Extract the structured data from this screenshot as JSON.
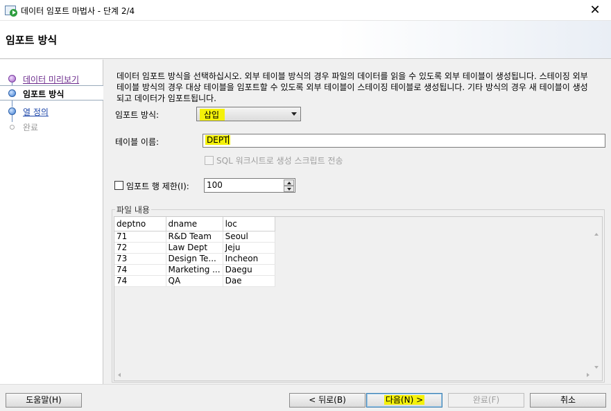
{
  "window": {
    "title": "데이터 임포트 마법사 - 단계 2/4",
    "close_glyph": "✕"
  },
  "header": {
    "title": "임포트 방식"
  },
  "steps": [
    {
      "label": "데이터 미리보기",
      "state": "visited"
    },
    {
      "label": "임포트 방식",
      "state": "current"
    },
    {
      "label": "열 정의",
      "state": "link"
    },
    {
      "label": "완료",
      "state": "disabled"
    }
  ],
  "description": "데이터 임포트 방식을 선택하십시오. 외부 테이블 방식의 경우 파일의 데이터를 읽을 수 있도록 외부 테이블이 생성됩니다. 스테이징 외부 테이블 방식의 경우 대상 테이블을 임포트할 수 있도록 외부 테이블이 스테이징 테이블로 생성됩니다. 기타 방식의 경우 새 테이블이 생성되고 데이터가 임포트됩니다.",
  "form": {
    "import_method_label": "임포트 방식:",
    "import_method_value": "삽입",
    "table_name_label": "테이블 이름:",
    "table_name_value": "DEPT",
    "sql_script_label": "SQL 워크시트로 생성 스크립트 전송",
    "limit_rows_label": "임포트 행 제한(I):",
    "limit_rows_value": "100",
    "limit_rows_checked": false
  },
  "file_contents": {
    "title": "파일 내용",
    "columns": [
      "deptno",
      "dname",
      "loc"
    ],
    "rows": [
      [
        "71",
        "R&D Team",
        "Seoul"
      ],
      [
        "72",
        "Law Dept",
        "Jeju"
      ],
      [
        "73",
        "Design Te...",
        " Incheon"
      ],
      [
        "74",
        "Marketing ...",
        " Daegu"
      ],
      [
        "74",
        "QA",
        "Dae"
      ]
    ]
  },
  "buttons": {
    "help": "도움말(H)",
    "back": "< 뒤로(B)",
    "next": "다음(N) >",
    "finish": "완료(F)",
    "cancel": "취소"
  },
  "colors": {
    "highlight": "#f4f10a",
    "link": "#1a44a8",
    "visited_link": "#6b2a8c"
  }
}
